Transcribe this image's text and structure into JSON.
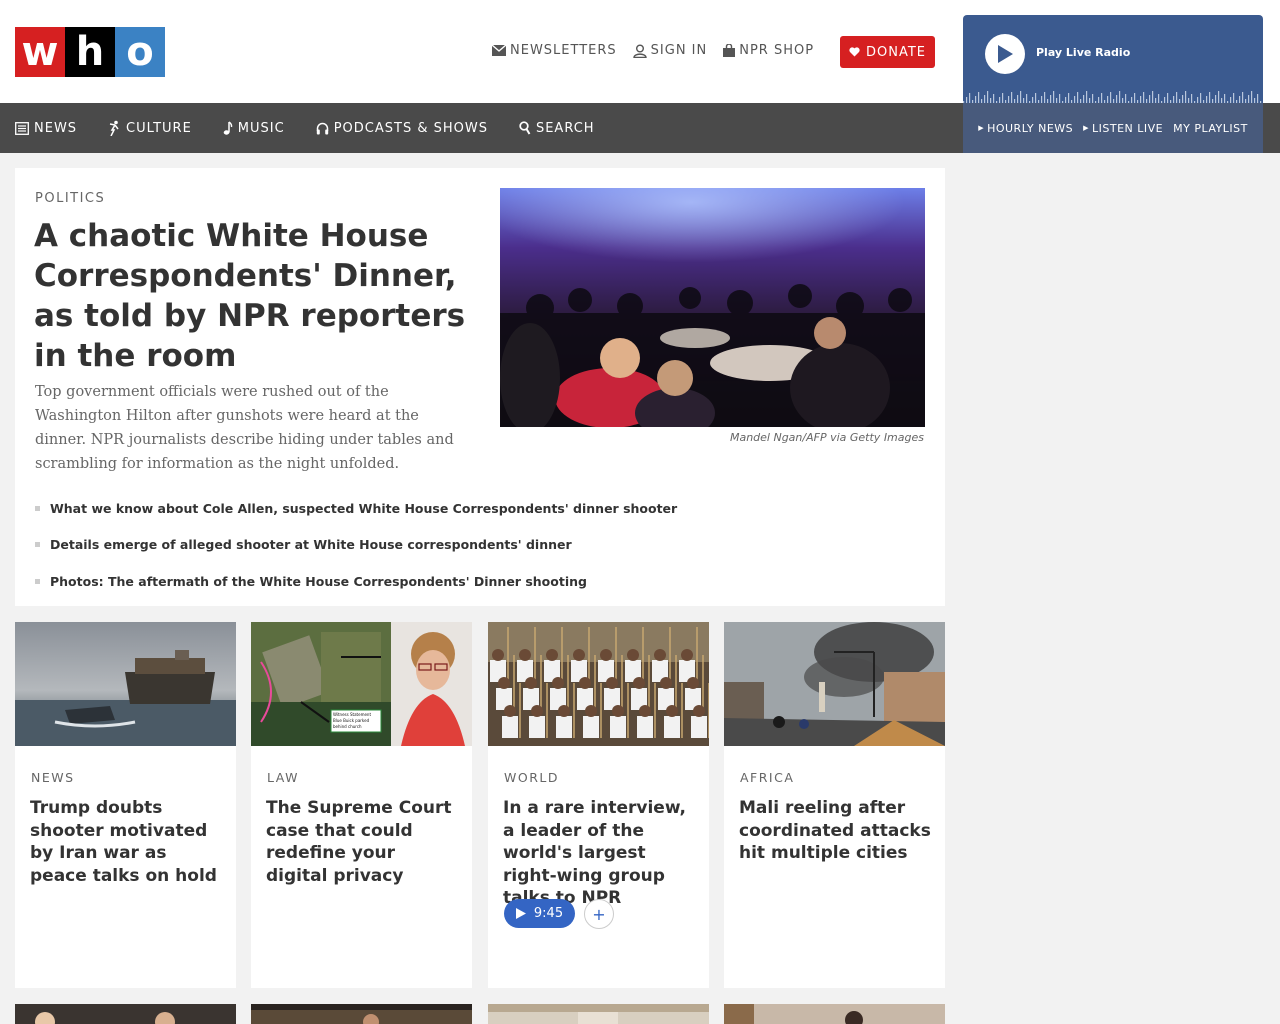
{
  "logo": {
    "letters": [
      "w",
      "h",
      "o"
    ],
    "colors": [
      "#d62021",
      "#000000",
      "#3b82c4"
    ]
  },
  "utility": {
    "newsletters": "NEWSLETTERS",
    "sign_in": "SIGN IN",
    "shop": "NPR SHOP",
    "donate": "DONATE"
  },
  "nav": {
    "items": [
      {
        "label": "NEWS",
        "icon": "news-icon"
      },
      {
        "label": "CULTURE",
        "icon": "culture-icon"
      },
      {
        "label": "MUSIC",
        "icon": "music-icon"
      },
      {
        "label": "PODCASTS & SHOWS",
        "icon": "headphones-icon"
      },
      {
        "label": "SEARCH",
        "icon": "search-icon"
      }
    ]
  },
  "player": {
    "label": "Play Live Radio",
    "links": [
      "HOURLY NEWS",
      "LISTEN LIVE",
      "MY PLAYLIST"
    ]
  },
  "hero": {
    "slug": "POLITICS",
    "title": "A chaotic White House Correspondents' Dinner, as told by NPR reporters in the room",
    "teaser": "Top government officials were rushed out of the Washington Hilton after gunshots were heard at the dinner. NPR journalists describe hiding under tables and scrambling for information as the night unfolded.",
    "credit": "Mandel Ngan/AFP via Getty Images",
    "related": [
      "What we know about Cole Allen, suspected White House Correspondents' dinner shooter",
      "Details emerge of alleged shooter at White House correspondents' dinner",
      "Photos: The aftermath of the White House Correspondents' Dinner shooting"
    ]
  },
  "cards": [
    {
      "slug": "NEWS",
      "title": "Trump doubts shooter motivated by Iran war as peace talks on hold"
    },
    {
      "slug": "LAW",
      "title": "The Supreme Court case that could redefine your digital privacy"
    },
    {
      "slug": "WORLD",
      "title": "In a rare interview, a leader of the world's largest right-wing group talks to NPR",
      "audio_duration": "9:45"
    },
    {
      "slug": "AFRICA",
      "title": "Mali reeling after coordinated attacks hit multiple cities"
    }
  ],
  "image_captions": {
    "map_label_1": "Witness Statement",
    "map_label_2": "Blue Buick parked",
    "map_label_3": "behind church"
  },
  "colors": {
    "brand_red": "#d62021",
    "nav_bg": "#4a4a4a",
    "player_bg": "#3b5a8f",
    "audio_blue": "#3465c4"
  }
}
